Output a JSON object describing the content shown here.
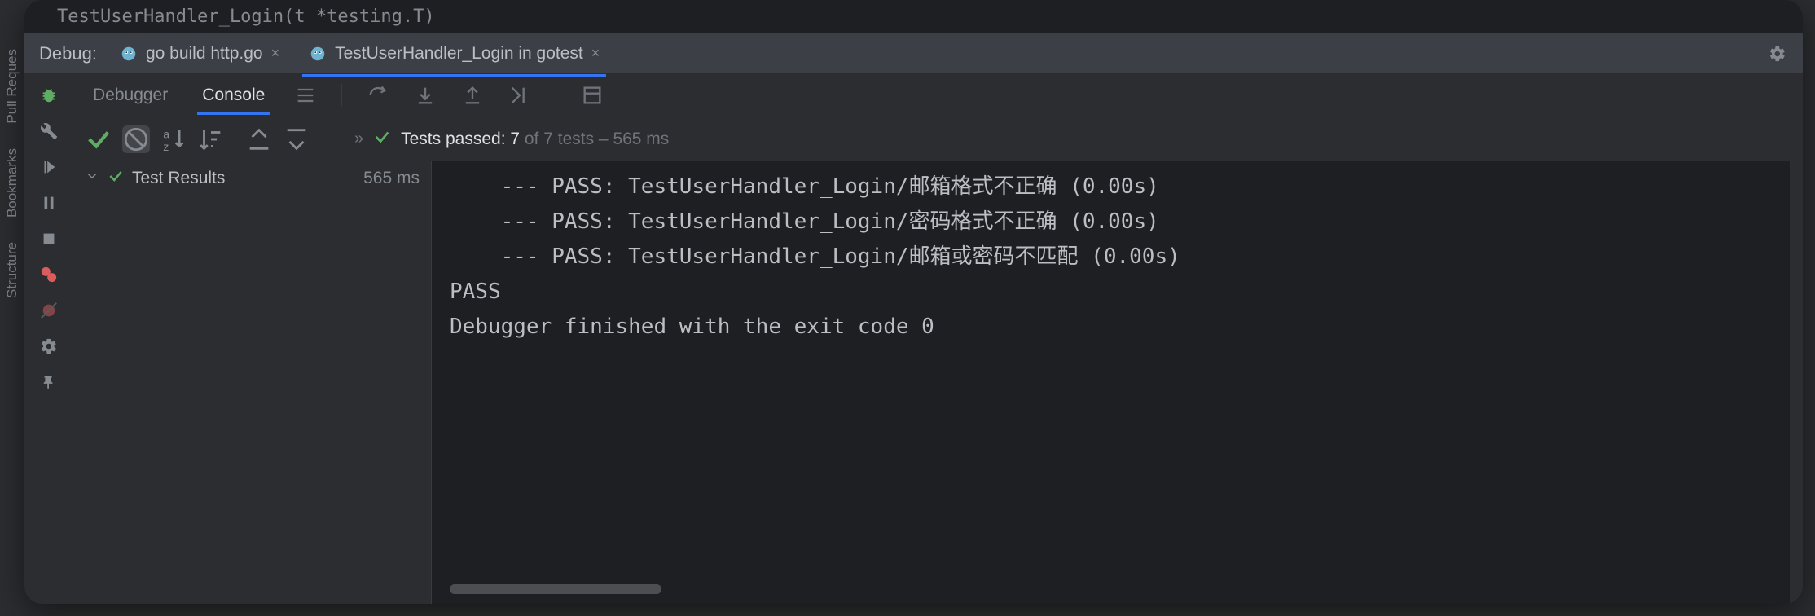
{
  "leftRail": {
    "p0": "Pull Reques",
    "p1": "Bookmarks",
    "p2": "Structure"
  },
  "editorPeek": "TestUserHandler_Login(t *testing.T)",
  "debug": {
    "label": "Debug:",
    "tabs": [
      {
        "label": "go build http.go",
        "active": false
      },
      {
        "label": "TestUserHandler_Login in gotest",
        "active": true
      }
    ]
  },
  "subtabs": {
    "debugger": "Debugger",
    "console": "Console"
  },
  "testsBar": {
    "prefix": "Tests passed: ",
    "passed": "7",
    "of": " of 7 tests – 565 ms"
  },
  "tree": {
    "root": "Test Results",
    "time": "565 ms"
  },
  "console": {
    "l1": "    --- PASS: TestUserHandler_Login/邮箱格式不正确 (0.00s)",
    "l2": "    --- PASS: TestUserHandler_Login/密码格式不正确 (0.00s)",
    "l3": "    --- PASS: TestUserHandler_Login/邮箱或密码不匹配 (0.00s)",
    "l4": "PASS",
    "l5": "",
    "l6": "Debugger finished with the exit code 0"
  }
}
